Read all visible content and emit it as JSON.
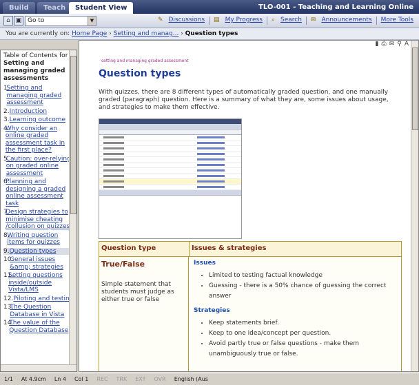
{
  "tabs": [
    "Build",
    "Teach",
    "Student View"
  ],
  "course_title": "TLO-001 - Teaching and Learning Online",
  "toolbar": {
    "goto_label": "Go to",
    "links": [
      "Discussions",
      "My Progress",
      "Search",
      "Announcements",
      "More Tools"
    ]
  },
  "breadcrumb": {
    "prefix": "You are currently on:",
    "items": [
      "Home Page",
      "Setting and manag..."
    ],
    "current": "Question types"
  },
  "toc": {
    "heading": "Table of Contents for",
    "subject": "Setting and managing graded assessments",
    "items": [
      {
        "n": "1.",
        "t": "Setting and managing graded assessment"
      },
      {
        "n": "2.",
        "t": "Introduction"
      },
      {
        "n": "3.",
        "t": "Learning outcome"
      },
      {
        "n": "4.",
        "t": "Why consider an online graded assessment task in the first place?"
      },
      {
        "n": "5.",
        "t": "Caution: over-relying on graded online assessment"
      },
      {
        "n": "6.",
        "t": "Planning and designing a graded online assessment task"
      },
      {
        "n": "7.",
        "t": "Design strategies to minimise cheating /collusion on quizzes"
      },
      {
        "n": "8.",
        "t": "Writing question items for quizzes"
      },
      {
        "n": "9.",
        "t": "Question types"
      },
      {
        "n": "10.",
        "t": "General issues &amp; strategies"
      },
      {
        "n": "11.",
        "t": "Setting questions inside/outside Vista/LMS"
      },
      {
        "n": "12.",
        "t": "Piloting and testing"
      },
      {
        "n": "13.",
        "t": "The Question Database in Vista"
      },
      {
        "n": "14.",
        "t": "The value of the Question Database"
      }
    ]
  },
  "content": {
    "small_header": "setting and managing graded assessment",
    "title": "Question types",
    "paragraph": "With quizzes, there are 8 different types of automatically graded question, and one manually graded (paragraph) question. Here is a summary of what they are, some issues about usage, and strategies to make them effective.",
    "table": {
      "col1_head": "Question type",
      "col2_head": "Issues & strategies",
      "type": "True/False",
      "description": "Simple statement that students must judge as either true or false",
      "issues_head": "Issues",
      "issues": [
        "Limited to testing factual knowledge",
        "Guessing - there is a 50% chance of guessing the correct answer"
      ],
      "strategies_head": "Strategies",
      "strategies": [
        "Keep statements brief.",
        "Keep to one idea/concept per question.",
        "Avoid partly true or false questions - make them unambiguously true or false."
      ]
    }
  },
  "statusbar": {
    "page": "1/1",
    "at": "At 4.9cm",
    "ln": "Ln 4",
    "col": "Col 1",
    "rec": "REC",
    "trk": "TRK",
    "ext": "EXT",
    "ovr": "OVR",
    "lang": "English (Aus"
  }
}
